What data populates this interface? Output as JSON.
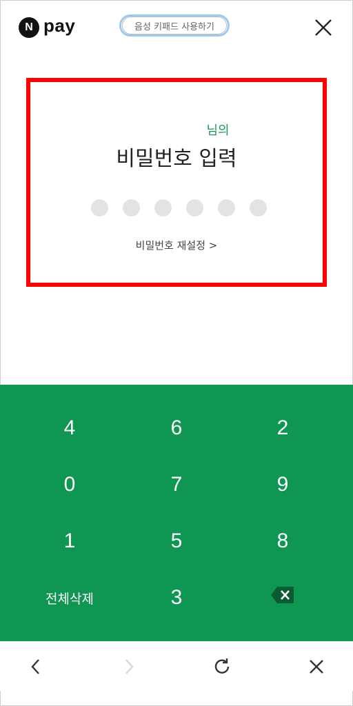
{
  "header": {
    "logo_letter": "N",
    "logo_text": "pay",
    "voice_keypad_label": "음성 키패드 사용하기"
  },
  "panel": {
    "username_suffix": "님의",
    "title": "비밀번호 입력",
    "pin_length": 6,
    "reset_link": "비밀번호 재설정 >"
  },
  "keypad": {
    "rows": [
      [
        "4",
        "6",
        "2"
      ],
      [
        "0",
        "7",
        "9"
      ],
      [
        "1",
        "5",
        "8"
      ],
      [
        "전체삭제",
        "3",
        "backspace"
      ]
    ],
    "clear_all_label": "전체삭제"
  },
  "colors": {
    "accent_green": "#0f9653",
    "highlight_border": "#ff0000",
    "voice_button_border": "#9cc9f2"
  },
  "icons": {
    "close": "close-icon",
    "backspace": "backspace-icon",
    "back": "chevron-left-icon",
    "forward": "chevron-right-icon",
    "refresh": "refresh-icon"
  }
}
